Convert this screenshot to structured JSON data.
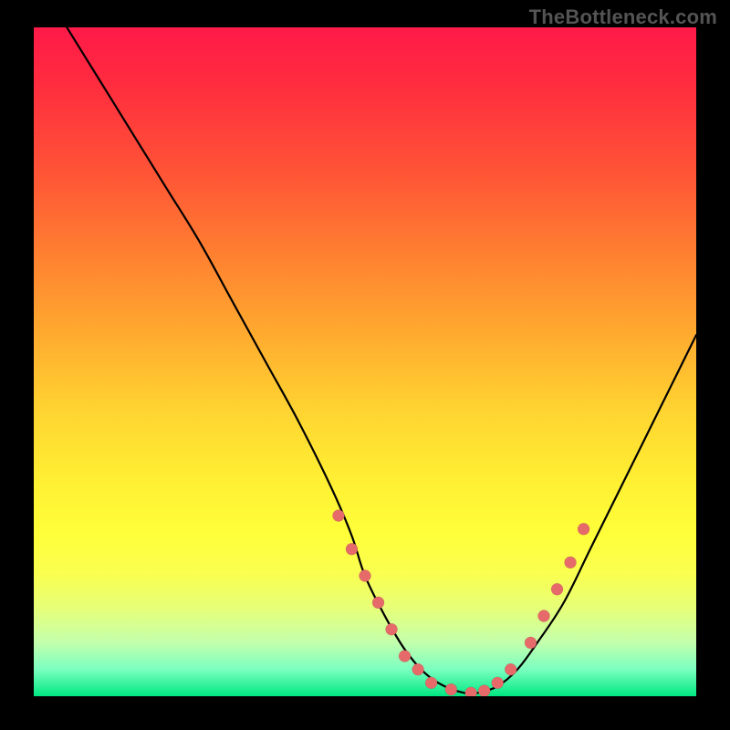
{
  "watermark": "TheBottleneck.com",
  "chart_data": {
    "type": "line",
    "title": "",
    "xlabel": "",
    "ylabel": "",
    "xlim": [
      0,
      100
    ],
    "ylim": [
      0,
      100
    ],
    "series": [
      {
        "name": "curve",
        "x": [
          5,
          10,
          15,
          20,
          25,
          30,
          35,
          40,
          45,
          48,
          50,
          53,
          56,
          59,
          62,
          65,
          67,
          70,
          73,
          76,
          80,
          84,
          88,
          92,
          96,
          100
        ],
        "y": [
          100,
          92,
          84,
          76,
          68,
          59,
          50,
          41,
          31,
          24,
          18,
          12,
          7,
          3.5,
          1.5,
          0.5,
          0.5,
          1.5,
          4,
          8,
          14,
          22,
          30,
          38,
          46,
          54
        ]
      },
      {
        "name": "markers",
        "x": [
          46,
          48,
          50,
          52,
          54,
          56,
          58,
          60,
          63,
          66,
          68,
          70,
          72,
          75,
          77,
          79,
          81,
          83
        ],
        "y": [
          27,
          22,
          18,
          14,
          10,
          6,
          4,
          2,
          1,
          0.5,
          0.8,
          2,
          4,
          8,
          12,
          16,
          20,
          25
        ]
      }
    ],
    "gradient_stops": [
      {
        "pos": 0,
        "color": "#ff1a49"
      },
      {
        "pos": 50,
        "color": "#ffd631"
      },
      {
        "pos": 80,
        "color": "#ffff3a"
      },
      {
        "pos": 100,
        "color": "#00e881"
      }
    ]
  }
}
